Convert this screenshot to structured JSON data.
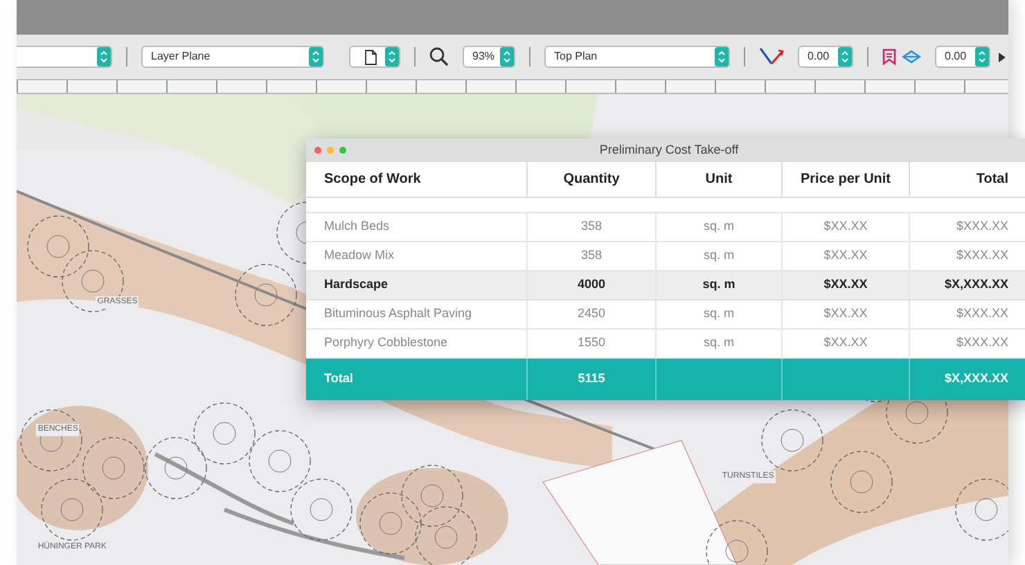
{
  "toolbar": {
    "layer_select": {
      "value": "Layer Plane"
    },
    "zoom_field": {
      "value": "93%"
    },
    "view_select": {
      "value": "Top Plan"
    },
    "rotation_field": {
      "value": "0.00"
    },
    "offset_field": {
      "value": "0.00"
    }
  },
  "map_labels": [
    {
      "text": "GRASSES"
    },
    {
      "text": "BENCHES"
    },
    {
      "text": "HÜNINGER PARK"
    },
    {
      "text": "TURNSTILES"
    }
  ],
  "cost_window": {
    "title": "Preliminary Cost Take-off",
    "columns": [
      "Scope of Work",
      "Quantity",
      "Unit",
      "Price per Unit",
      "Total"
    ],
    "rows": [
      {
        "kind": "item",
        "cells": [
          "Mulch Beds",
          "358",
          "sq. m",
          "$XX.XX",
          "$XXX.XX"
        ]
      },
      {
        "kind": "item",
        "cells": [
          "Meadow Mix",
          "358",
          "sq. m",
          "$XX.XX",
          "$XXX.XX"
        ]
      },
      {
        "kind": "category",
        "cells": [
          "Hardscape",
          "4000",
          "sq. m",
          "$XX.XX",
          "$X,XXX.XX"
        ]
      },
      {
        "kind": "item",
        "cells": [
          "Bituminous Asphalt Paving",
          "2450",
          "sq. m",
          "$XX.XX",
          "$XXX.XX"
        ]
      },
      {
        "kind": "item",
        "cells": [
          "Porphyry Cobblestone",
          "1550",
          "sq. m",
          "$XX.XX",
          "$XXX.XX"
        ]
      },
      {
        "kind": "total",
        "cells": [
          "Total",
          "5115",
          "",
          "",
          "$X,XXX.XX"
        ]
      }
    ]
  }
}
